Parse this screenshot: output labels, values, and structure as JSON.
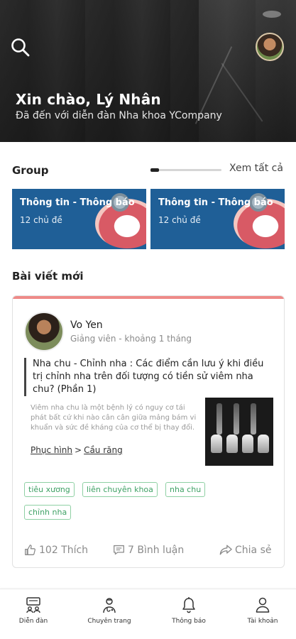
{
  "header": {
    "greeting": "Xin chào, Lý Nhân",
    "subtitle": "Đã đến với diễn đàn Nha khoa YCompany",
    "search_icon": "search-icon",
    "avatar_icon": "user-avatar"
  },
  "groups": {
    "title": "Group",
    "see_all": "Xem tất cả",
    "items": [
      {
        "name": "Thông tin - Thông báo",
        "count": "12 chủ đề"
      },
      {
        "name": "Thông tin - Thông báo",
        "count": "12 chủ đề"
      }
    ],
    "card_color": "#1f5f97"
  },
  "posts": {
    "title": "Bài viết mới",
    "accent": "#ee8a88",
    "items": [
      {
        "author": "Vo Yen",
        "meta": "Giảng viên - khoảng 1 tháng",
        "heading": "Nha chu - Chỉnh nha : Các điểm cần lưu ý khi điều trị chỉnh nha trên đối tượng có tiền sử viêm nha chu? (Phần 1)",
        "excerpt": "Viêm nha chu là một bệnh lý có nguy cơ tái phát bất cứ khi nào cân cân giữa mảng bám vi khuẩn và sức đề kháng của cơ thể bị thay đổi.",
        "breadcrumb": [
          "Phục hình",
          "Cầu răng"
        ],
        "breadcrumb_sep": ">",
        "tags": [
          "tiêu xương",
          "liên chuyên khoa",
          "nha chu",
          "chỉnh nha"
        ],
        "tag_color": "#3fa165",
        "likes": "102 Thích",
        "comments": "7 Bình luận",
        "share": "Chia sẻ"
      }
    ]
  },
  "bottom_nav": {
    "items": [
      {
        "label": "Diễn đàn",
        "icon": "forum-icon"
      },
      {
        "label": "Chuyên trang",
        "icon": "doctor-icon"
      },
      {
        "label": "Thông báo",
        "icon": "bell-icon"
      },
      {
        "label": "Tài khoản",
        "icon": "user-icon"
      }
    ]
  }
}
